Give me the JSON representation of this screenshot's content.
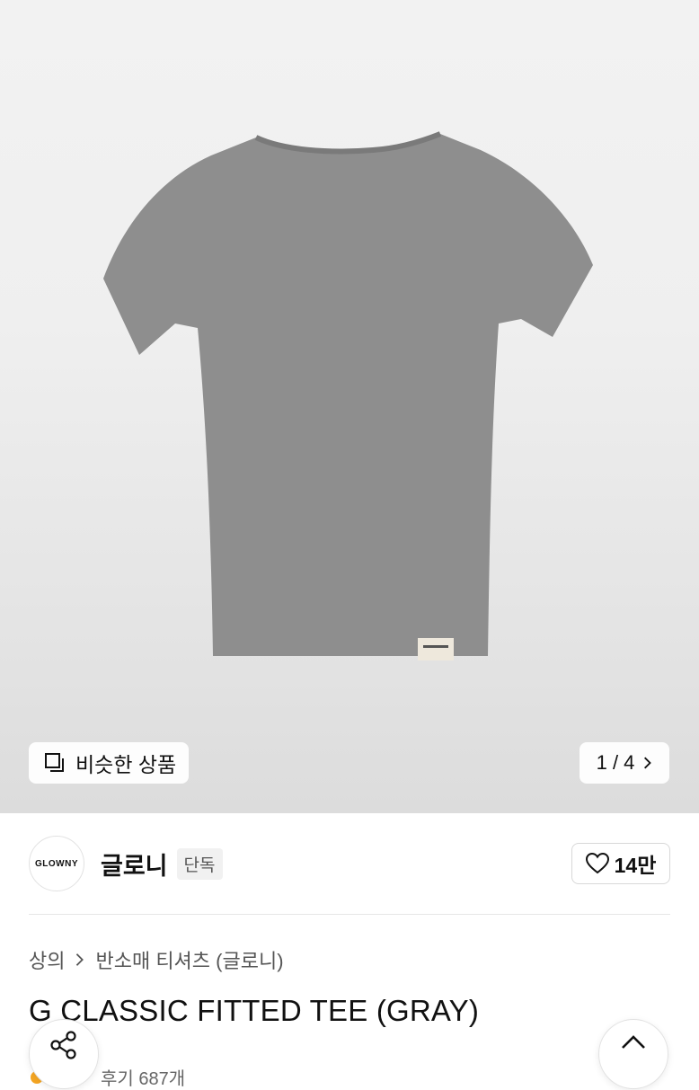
{
  "gallery": {
    "image_icon": "gray-fitted-tee-image",
    "similar_label": "비슷한 상품",
    "similar_icon": "similar-items-icon",
    "page_indicator": "1 / 4",
    "next_icon": "chevron-right-icon"
  },
  "brand": {
    "logo_text": "GLOWNY",
    "name": "글로니",
    "badge": "단독",
    "like_icon": "heart-outline-icon",
    "like_count": "14만"
  },
  "breadcrumb": {
    "category": "상의",
    "separator_icon": "chevron-right-icon",
    "subcategory": "반소매 티셔츠 (글로니)"
  },
  "product": {
    "title": "G CLASSIC FITTED TEE (GRAY)",
    "review_text": "후기 687개"
  },
  "floating": {
    "share_icon": "share-icon",
    "top_icon": "chevron-up-icon"
  },
  "colors": {
    "shirt": "#8e8e8e",
    "rating_star": "#f5a623"
  }
}
